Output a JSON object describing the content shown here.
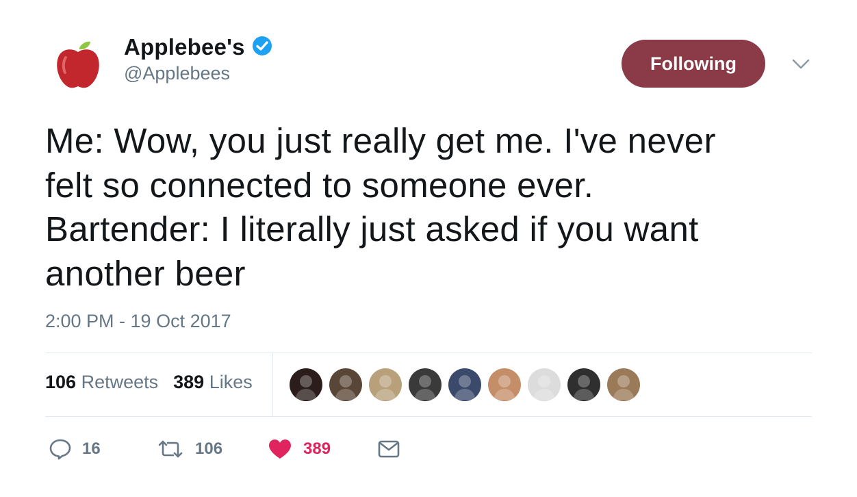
{
  "account": {
    "display_name": "Applebee's",
    "handle": "@Applebees",
    "verified": true,
    "avatar_icon": "apple-logo-icon"
  },
  "follow_button": {
    "label": "Following",
    "color": "#8b3a48"
  },
  "tweet": {
    "lines": [
      "Me: Wow, you just really get me. I've never",
      "felt so connected to someone ever.",
      "Bartender: I literally just asked if you want",
      "another beer"
    ],
    "timestamp": "2:00 PM - 19 Oct 2017"
  },
  "stats": {
    "retweets_count": "106",
    "retweets_label": "Retweets",
    "likes_count": "389",
    "likes_label": "Likes"
  },
  "liked_by_avatars": [
    {
      "icon": "user-avatar-icon",
      "color": "#2a1d1a"
    },
    {
      "icon": "user-avatar-icon",
      "color": "#5a4636"
    },
    {
      "icon": "user-avatar-icon",
      "color": "#b8a07a"
    },
    {
      "icon": "user-avatar-icon",
      "color": "#3a3a3a"
    },
    {
      "icon": "user-avatar-icon",
      "color": "#3b4a6b"
    },
    {
      "icon": "user-avatar-icon",
      "color": "#c48e68"
    },
    {
      "icon": "user-avatar-icon",
      "color": "#dcdcdc"
    },
    {
      "icon": "user-avatar-icon",
      "color": "#2f2f2f"
    },
    {
      "icon": "user-avatar-icon",
      "color": "#9a7a58"
    }
  ],
  "actions": {
    "reply": {
      "icon": "reply-icon",
      "count": "16"
    },
    "retweet": {
      "icon": "retweet-icon",
      "count": "106"
    },
    "like": {
      "icon": "heart-icon",
      "count": "389",
      "active": true,
      "color": "#e0245e"
    },
    "message": {
      "icon": "envelope-icon"
    }
  }
}
